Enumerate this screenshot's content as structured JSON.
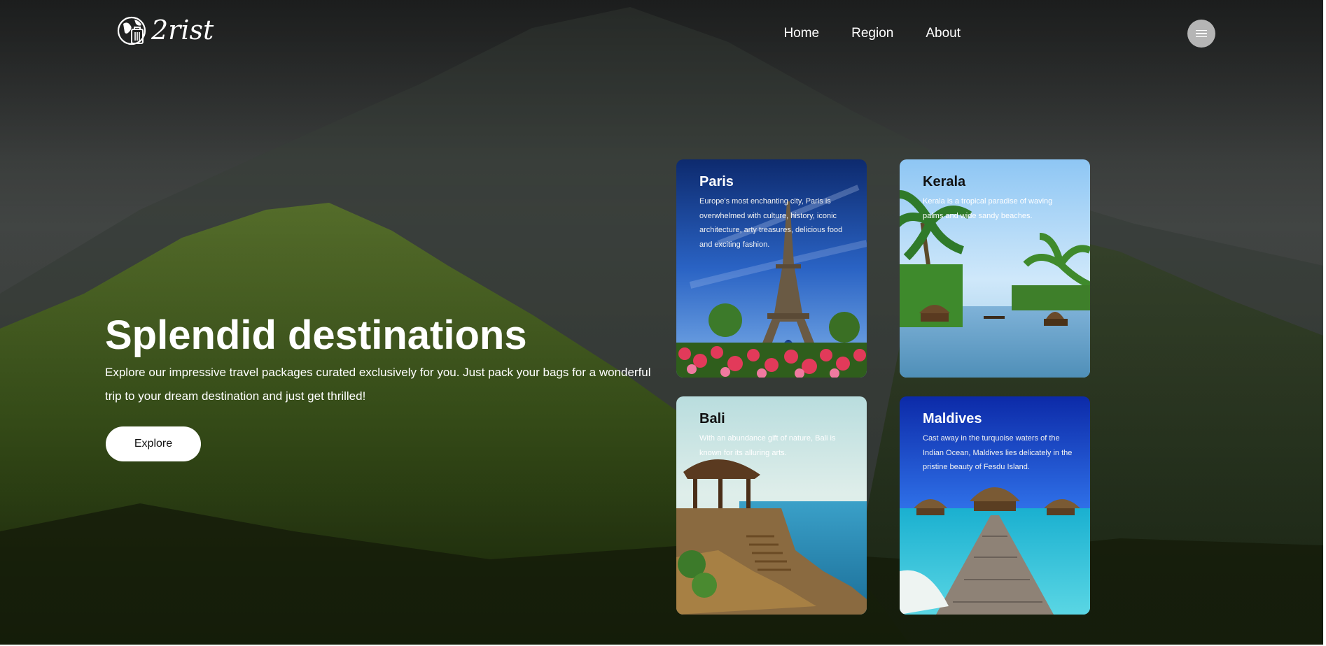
{
  "brand": {
    "name": "2rist",
    "logo_icon": "globe-luggage-icon"
  },
  "nav": {
    "items": [
      {
        "label": "Home"
      },
      {
        "label": "Region"
      },
      {
        "label": "About"
      }
    ],
    "menu_icon": "hamburger-icon"
  },
  "hero": {
    "title": "Splendid destinations",
    "description": "Explore our impressive travel packages curated exclusively for you. Just pack your bags for a wonderful trip to your dream destination and just get thrilled!",
    "cta_label": "Explore"
  },
  "destinations": [
    {
      "name": "Paris",
      "description": "Europe's most enchanting city, Paris is overwhelmed with culture, history, iconic architecture, arty treasures, delicious food and exciting fashion."
    },
    {
      "name": "Kerala",
      "description": "Kerala is a tropical paradise of waving palms and wide sandy beaches."
    },
    {
      "name": "Bali",
      "description": "With an abundance gift of nature, Bali is known for its alluring arts."
    },
    {
      "name": "Maldives",
      "description": "Cast away in the turquoise waters of the Indian Ocean, Maldives lies delicately in the pristine beauty of Fesdu Island."
    }
  ],
  "colors": {
    "text": "#ffffff",
    "button_bg": "#ffffff",
    "menu_button_bg": "#b5b5b5"
  }
}
